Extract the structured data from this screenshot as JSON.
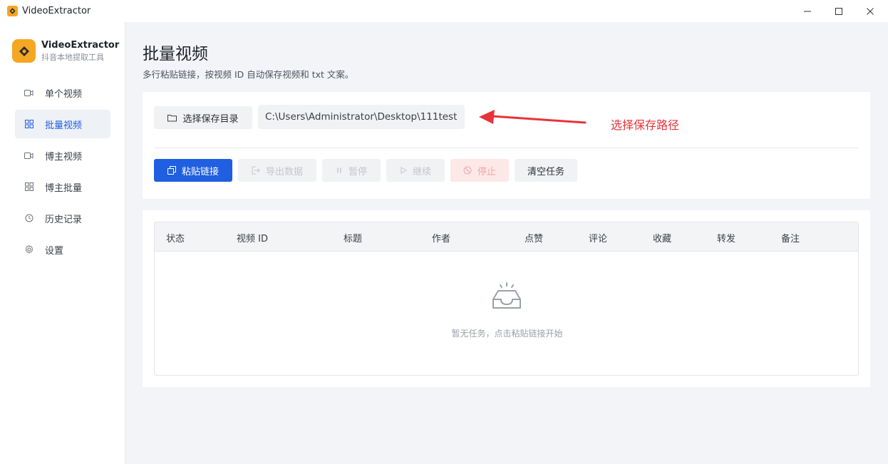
{
  "window": {
    "title": "VideoExtractor",
    "controls": [
      "minimize",
      "maximize",
      "close"
    ]
  },
  "brand": {
    "name": "VideoExtractor",
    "subtitle": "抖音本地提取工具",
    "color": "#f5a623"
  },
  "sidebar": {
    "items": [
      {
        "label": "单个视频",
        "icon": "video-camera-icon",
        "active": false
      },
      {
        "label": "批量视频",
        "icon": "grid-icon",
        "active": true
      },
      {
        "label": "博主视频",
        "icon": "video-camera-icon",
        "active": false
      },
      {
        "label": "博主批量",
        "icon": "grid-icon",
        "active": false
      },
      {
        "label": "历史记录",
        "icon": "history-icon",
        "active": false
      },
      {
        "label": "设置",
        "icon": "gear-icon",
        "active": false
      }
    ]
  },
  "page": {
    "title": "批量视频",
    "description": "多行粘贴链接，按视频 ID 自动保存视频和 txt 文案。"
  },
  "save": {
    "button_label": "选择保存目录",
    "path": "C:\\Users\\Administrator\\Desktop\\111test"
  },
  "toolbar": {
    "paste_label": "粘贴链接",
    "export_label": "导出数据",
    "pause_label": "暂停",
    "resume_label": "继续",
    "stop_label": "停止",
    "clear_label": "清空任务"
  },
  "table": {
    "columns": [
      "状态",
      "视频 ID",
      "标题",
      "作者",
      "点赞",
      "评论",
      "收藏",
      "转发",
      "备注"
    ],
    "rows": [],
    "empty_text": "暂无任务，点击粘贴链接开始"
  },
  "annotation": {
    "text": "选择保存路径",
    "color": "#e8333a"
  },
  "colors": {
    "primary": "#1f5fe0",
    "danger_bg": "#fde8e8",
    "danger_text": "#f4a5a5"
  }
}
